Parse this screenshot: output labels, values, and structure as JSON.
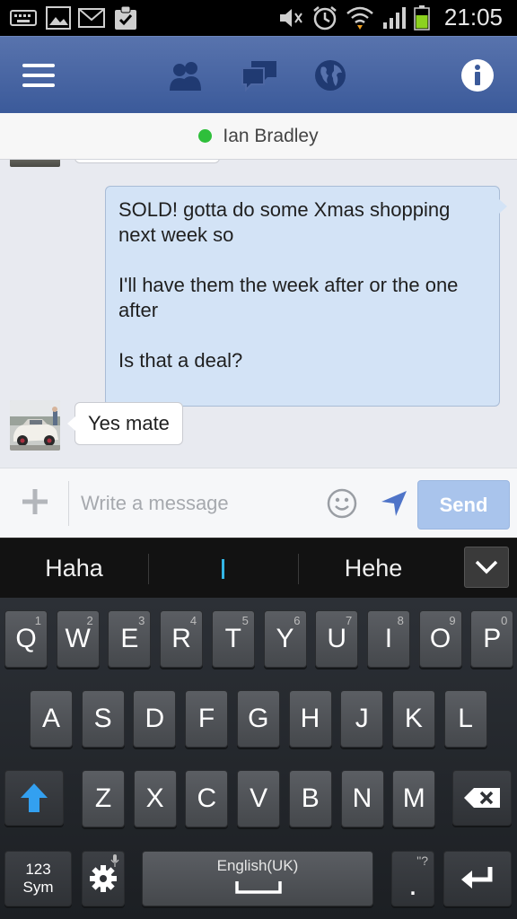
{
  "status_bar": {
    "time": "21:05",
    "icons": [
      "keyboard-icon",
      "gallery-icon",
      "mail-icon",
      "clipboard-check-icon",
      "mute-icon",
      "alarm-icon",
      "wifi-icon",
      "signal-icon",
      "battery-icon"
    ]
  },
  "topbar": {
    "icons": [
      "menu-icon",
      "friends-icon",
      "messages-icon",
      "globe-icon",
      "info-icon"
    ],
    "brand_color": "#3b5a9a"
  },
  "chat": {
    "contact_name": "Ian Bradley",
    "online_color": "#2fbf3b",
    "outgoing_message": [
      "SOLD! gotta do some Xmas shopping next week so",
      "I'll have them the week after or the one after",
      "Is that a deal?"
    ],
    "incoming_message": "Yes mate"
  },
  "composer": {
    "placeholder": "Write a message",
    "send_label": "Send"
  },
  "suggestions": {
    "left": "Haha",
    "middle": "",
    "right": "Hehe"
  },
  "keyboard": {
    "row1": [
      {
        "k": "Q",
        "n": "1"
      },
      {
        "k": "W",
        "n": "2"
      },
      {
        "k": "E",
        "n": "3"
      },
      {
        "k": "R",
        "n": "4"
      },
      {
        "k": "T",
        "n": "5"
      },
      {
        "k": "Y",
        "n": "6"
      },
      {
        "k": "U",
        "n": "7"
      },
      {
        "k": "I",
        "n": "8"
      },
      {
        "k": "O",
        "n": "9"
      },
      {
        "k": "P",
        "n": "0"
      }
    ],
    "row2": [
      "A",
      "S",
      "D",
      "F",
      "G",
      "H",
      "J",
      "K",
      "L"
    ],
    "row3": [
      "Z",
      "X",
      "C",
      "V",
      "B",
      "N",
      "M"
    ],
    "sym_label_1": "123",
    "sym_label_2": "Sym",
    "space_label": "English(UK)",
    "period_label": ".",
    "period_hint": "\"?",
    "shift_color": "#33a0f0"
  }
}
